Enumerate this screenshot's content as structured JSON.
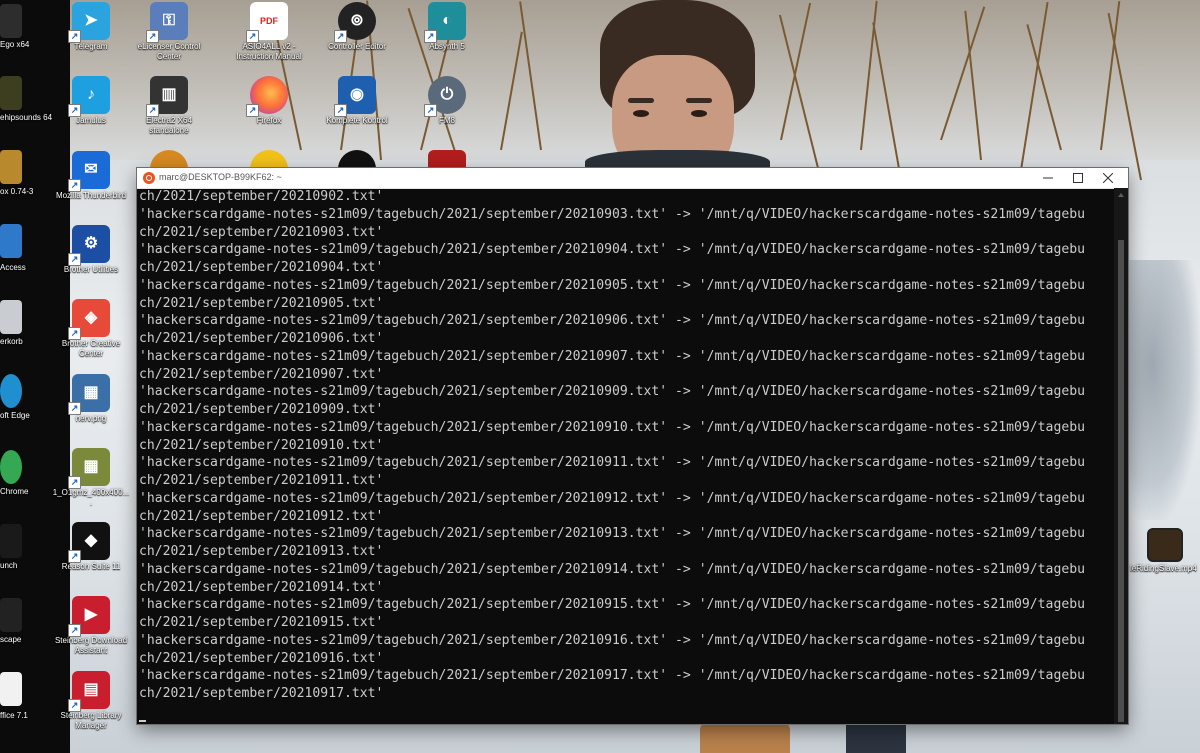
{
  "desktop": {
    "icons_col1": [
      {
        "label": "Telegram",
        "icon": "telegram-icon",
        "color": "#2aa3df"
      },
      {
        "label": "Jamulus",
        "icon": "jamulus-icon",
        "color": "#1e9fe0"
      },
      {
        "label": "Mozilla Thunderbird",
        "icon": "thunderbird-icon",
        "color": "#1a6bd8"
      },
      {
        "label": "Brother Utilities",
        "icon": "brother-utilities-icon",
        "color": "#1c4fa3"
      },
      {
        "label": "Brother Creative Center",
        "icon": "brother-creative-icon",
        "color": "#e84a3a"
      },
      {
        "label": "nerv.png",
        "icon": "image-file-icon",
        "color": "#3a6fa8"
      },
      {
        "label": "1_O1gmz_400x400....",
        "icon": "image-file-icon",
        "color": "#7a8a3a"
      },
      {
        "label": "Reason Suite 11",
        "icon": "reason-icon",
        "color": "#111111"
      },
      {
        "label": "Steinberg Download Assistant",
        "icon": "steinberg-download-icon",
        "color": "#c81e2e"
      },
      {
        "label": "Steinberg Library Manager",
        "icon": "steinberg-library-icon",
        "color": "#c81e2e"
      }
    ],
    "icons_col2": [
      {
        "label": "eLicenser Control Center",
        "icon": "elicenser-icon",
        "color": "#5a7dbb"
      },
      {
        "label": "Electra2 X64 standalone",
        "icon": "electra-icon",
        "color": "#333333"
      }
    ],
    "icons_col3": [
      {
        "label": "ASIO4ALL v2 - Instruction Manual",
        "icon": "pdf-icon",
        "color": "#d8241c"
      },
      {
        "label": "Firefox",
        "icon": "firefox-icon",
        "color": "#ff7139"
      }
    ],
    "icons_col4": [
      {
        "label": "Controller Editor",
        "icon": "controller-editor-icon",
        "color": "#222222"
      },
      {
        "label": "Komplete Kontrol",
        "icon": "komplete-kontrol-icon",
        "color": "#1f5fb0"
      }
    ],
    "icons_col5": [
      {
        "label": "Absynth 5",
        "icon": "absynth-icon",
        "color": "#1e8f9a"
      },
      {
        "label": "FM8",
        "icon": "fm8-icon",
        "color": "#5a6a7a"
      }
    ],
    "edge_labels": [
      "Ego x64",
      "ehipsounds 64",
      "ox 0.74-3",
      "Access",
      "erkorb",
      "oft Edge",
      "Chrome",
      "unch",
      "scape",
      "ffice 7.1"
    ],
    "right_file_label": "leRidingSlave.mp4"
  },
  "terminal": {
    "title": "marc@DESKTOP-B99KF62: ~",
    "lines": [
      "ch/2021/september/20210902.txt'",
      "'hackerscardgame-notes-s21m09/tagebuch/2021/september/20210903.txt' -> '/mnt/q/VIDEO/hackerscardgame-notes-s21m09/tagebu",
      "ch/2021/september/20210903.txt'",
      "'hackerscardgame-notes-s21m09/tagebuch/2021/september/20210904.txt' -> '/mnt/q/VIDEO/hackerscardgame-notes-s21m09/tagebu",
      "ch/2021/september/20210904.txt'",
      "'hackerscardgame-notes-s21m09/tagebuch/2021/september/20210905.txt' -> '/mnt/q/VIDEO/hackerscardgame-notes-s21m09/tagebu",
      "ch/2021/september/20210905.txt'",
      "'hackerscardgame-notes-s21m09/tagebuch/2021/september/20210906.txt' -> '/mnt/q/VIDEO/hackerscardgame-notes-s21m09/tagebu",
      "ch/2021/september/20210906.txt'",
      "'hackerscardgame-notes-s21m09/tagebuch/2021/september/20210907.txt' -> '/mnt/q/VIDEO/hackerscardgame-notes-s21m09/tagebu",
      "ch/2021/september/20210907.txt'",
      "'hackerscardgame-notes-s21m09/tagebuch/2021/september/20210909.txt' -> '/mnt/q/VIDEO/hackerscardgame-notes-s21m09/tagebu",
      "ch/2021/september/20210909.txt'",
      "'hackerscardgame-notes-s21m09/tagebuch/2021/september/20210910.txt' -> '/mnt/q/VIDEO/hackerscardgame-notes-s21m09/tagebu",
      "ch/2021/september/20210910.txt'",
      "'hackerscardgame-notes-s21m09/tagebuch/2021/september/20210911.txt' -> '/mnt/q/VIDEO/hackerscardgame-notes-s21m09/tagebu",
      "ch/2021/september/20210911.txt'",
      "'hackerscardgame-notes-s21m09/tagebuch/2021/september/20210912.txt' -> '/mnt/q/VIDEO/hackerscardgame-notes-s21m09/tagebu",
      "ch/2021/september/20210912.txt'",
      "'hackerscardgame-notes-s21m09/tagebuch/2021/september/20210913.txt' -> '/mnt/q/VIDEO/hackerscardgame-notes-s21m09/tagebu",
      "ch/2021/september/20210913.txt'",
      "'hackerscardgame-notes-s21m09/tagebuch/2021/september/20210914.txt' -> '/mnt/q/VIDEO/hackerscardgame-notes-s21m09/tagebu",
      "ch/2021/september/20210914.txt'",
      "'hackerscardgame-notes-s21m09/tagebuch/2021/september/20210915.txt' -> '/mnt/q/VIDEO/hackerscardgame-notes-s21m09/tagebu",
      "ch/2021/september/20210915.txt'",
      "'hackerscardgame-notes-s21m09/tagebuch/2021/september/20210916.txt' -> '/mnt/q/VIDEO/hackerscardgame-notes-s21m09/tagebu",
      "ch/2021/september/20210916.txt'",
      "'hackerscardgame-notes-s21m09/tagebuch/2021/september/20210917.txt' -> '/mnt/q/VIDEO/hackerscardgame-notes-s21m09/tagebu",
      "ch/2021/september/20210917.txt'"
    ],
    "colors": {
      "background": "#0c0c0c",
      "text": "#cccccc",
      "titlebar": "#ffffff",
      "app_icon": "#e95420"
    }
  }
}
